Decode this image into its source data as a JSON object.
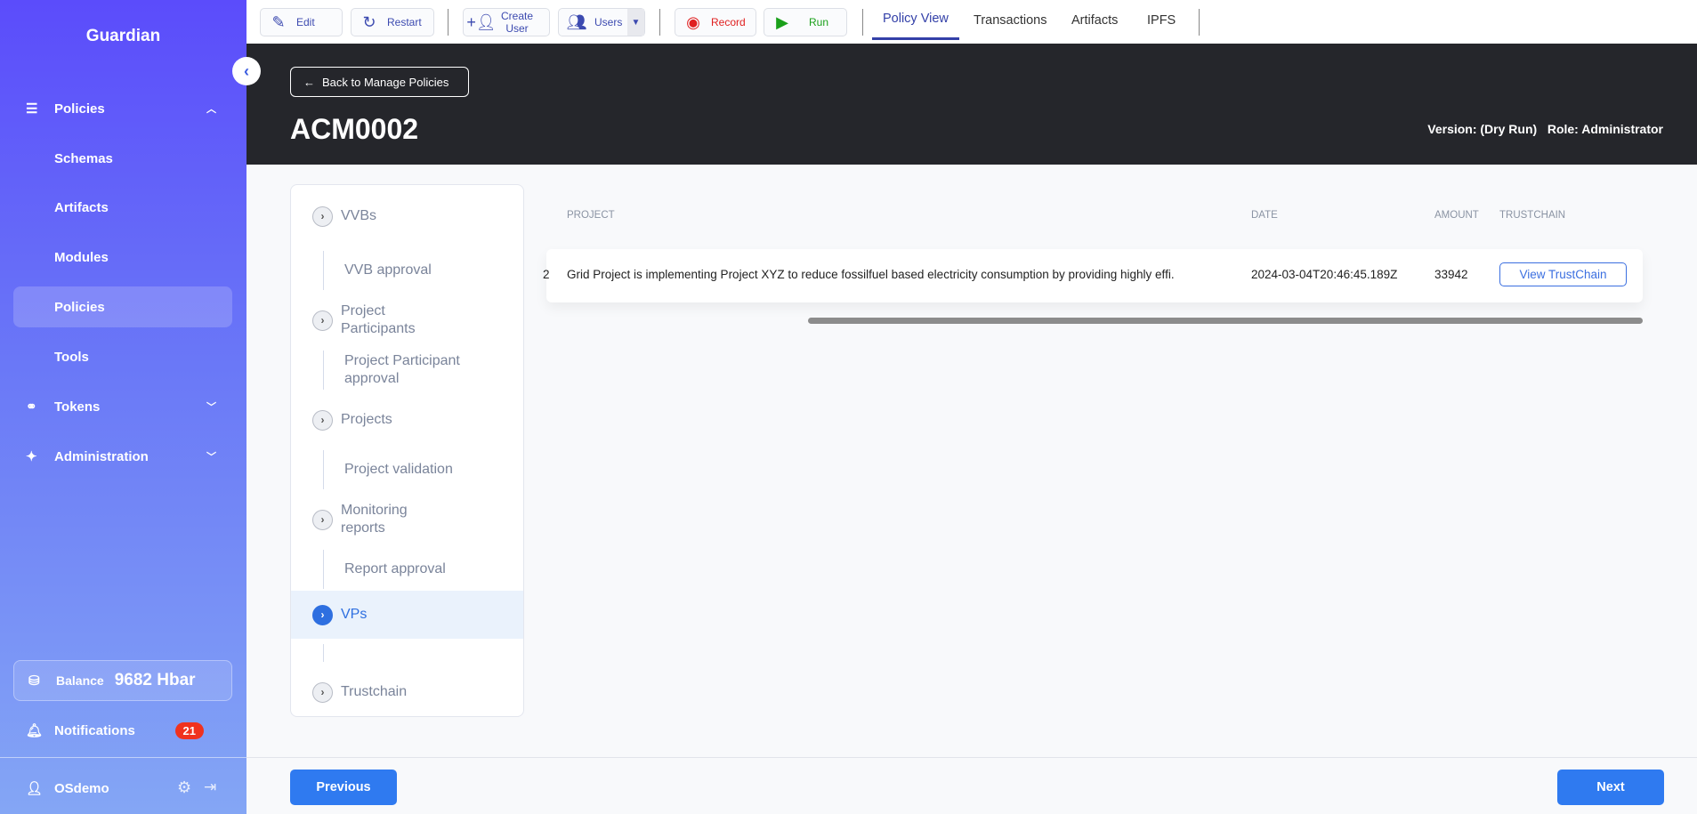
{
  "sidebar": {
    "brand": "Guardian",
    "items": [
      {
        "label": "Policies",
        "icon": "list-icon",
        "chevron": "up"
      },
      {
        "label": "Schemas"
      },
      {
        "label": "Artifacts"
      },
      {
        "label": "Modules"
      },
      {
        "label": "Policies",
        "active": true
      },
      {
        "label": "Tools"
      },
      {
        "label": "Tokens",
        "icon": "tokens-icon",
        "chevron": "down"
      },
      {
        "label": "Administration",
        "icon": "sparkle-icon",
        "chevron": "down"
      }
    ],
    "balance_label": "Balance",
    "balance_value": "9682 Hbar",
    "notifications_label": "Notifications",
    "notifications_count": "21",
    "user": "OSdemo"
  },
  "toolbar": {
    "edit": "Edit",
    "restart": "Restart",
    "create_user": "Create User",
    "users": "Users",
    "record": "Record",
    "run": "Run",
    "tabs": [
      "Policy View",
      "Transactions",
      "Artifacts",
      "IPFS"
    ],
    "active_tab": "Policy View"
  },
  "header": {
    "back": "Back to Manage Policies",
    "title": "ACM0002",
    "version": "Version: (Dry Run)",
    "role": "Role: Administrator"
  },
  "nav": [
    {
      "label": "VVBs",
      "type": "group"
    },
    {
      "label": "VVB approval",
      "type": "sub"
    },
    {
      "label": "Project Participants",
      "type": "group"
    },
    {
      "label": "Project Participant approval",
      "type": "sub"
    },
    {
      "label": "Projects",
      "type": "group"
    },
    {
      "label": "Project validation",
      "type": "sub"
    },
    {
      "label": "Monitoring reports",
      "type": "group"
    },
    {
      "label": "Report approval",
      "type": "sub"
    },
    {
      "label": "VPs",
      "type": "group",
      "active": true
    },
    {
      "label": "",
      "type": "sub"
    },
    {
      "label": "Trustchain",
      "type": "group"
    }
  ],
  "table": {
    "headers": [
      "PROJECT",
      "DATE",
      "AMOUNT",
      "TRUSTCHAIN"
    ],
    "rows": [
      {
        "prefix": "2",
        "project": "Grid Project is implementing Project XYZ to reduce fossilfuel based electricity consumption by providing highly effi.",
        "date": "2024-03-04T20:46:45.189Z",
        "amount": "33942",
        "action": "View TrustChain"
      }
    ]
  },
  "footer": {
    "previous": "Previous",
    "next": "Next"
  },
  "colors": {
    "accent": "#2f7af0",
    "header_bg": "#25262b",
    "badge": "#f0321e"
  }
}
